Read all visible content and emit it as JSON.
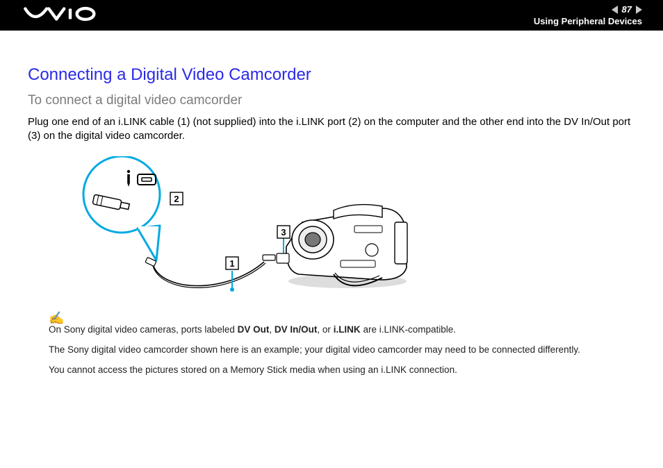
{
  "header": {
    "page_number": "87",
    "section": "Using Peripheral Devices"
  },
  "content": {
    "title": "Connecting a Digital Video Camcorder",
    "subtitle": "To connect a digital video camcorder",
    "intro": "Plug one end of an i.LINK cable (1) (not supplied) into the i.LINK port (2) on the computer and the other end into the DV In/Out port (3) on the digital video camcorder.",
    "callouts": {
      "c1": "1",
      "c2": "2",
      "c3": "3"
    },
    "notes": {
      "n1_prefix": "On Sony digital video cameras, ports labeled ",
      "n1_b1": "DV Out",
      "n1_sep1": ", ",
      "n1_b2": "DV In/Out",
      "n1_sep2": ", or ",
      "n1_b3": "i.LINK",
      "n1_suffix": " are i.LINK-compatible.",
      "n2": "The Sony digital video camcorder shown here is an example; your digital video camcorder may need to be connected differently.",
      "n3": "You cannot access the pictures stored on a Memory Stick media when using an i.LINK connection."
    }
  }
}
